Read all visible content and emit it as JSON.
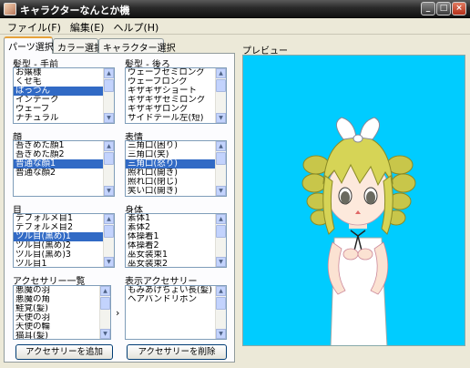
{
  "window": {
    "title": "キャラクターなんとか機",
    "buttons": {
      "minimize": "_",
      "maximize": "□",
      "close": "×"
    }
  },
  "menu": [
    "ファイル(F)",
    "編集(E)",
    "ヘルプ(H)"
  ],
  "tabs": [
    "パーツ選択",
    "カラー選択",
    "キャラクター選択"
  ],
  "parts": {
    "hair_front": {
      "label": "髪型 - 手前",
      "items": [
        "お嬢様",
        "くせ毛",
        "ぱっつん",
        "インテーク",
        "ウェーブ",
        "ナチュラル"
      ],
      "selected_index": 2
    },
    "hair_back": {
      "label": "髪型 - 後ろ",
      "items": [
        "ウェーブセミロング",
        "ウェーブロング",
        "ギザギザショート",
        "ギザギザセミロング",
        "ギザギザロング",
        "サイドテール左(短)"
      ],
      "selected_index": -1
    },
    "face": {
      "label": "顔",
      "items": [
        "吾ぎめた顔1",
        "吾ぎめた顔2",
        "普通な顔1",
        "普通な顔2"
      ],
      "selected_index": 2
    },
    "expression": {
      "label": "表情",
      "items": [
        "三角口(困り)",
        "三角口(笑)",
        "三角口(怒り)",
        "照れ口(開き)",
        "照れ口(閉じ)",
        "笑い口(開き)"
      ],
      "selected_index": 2
    },
    "eyes": {
      "label": "目",
      "items": [
        "デフォルメ目1",
        "デフォルメ目2",
        "ツル目(黒め)1",
        "ツル目(黒め)2",
        "ツル目(黒め)3",
        "ツル目1"
      ],
      "selected_index": 2
    },
    "body": {
      "label": "身体",
      "items": [
        "素体1",
        "素体2",
        "体操着1",
        "体操着2",
        "巫女装束1",
        "巫女装束2"
      ],
      "selected_index": -1
    },
    "accessory_list": {
      "label": "アクセサリー一覧",
      "items": [
        "悪魔の羽",
        "悪魔の角",
        "鮭覚(髪)",
        "天使の羽",
        "天使の輪",
        "猫耳(髪)"
      ],
      "selected_index": -1
    },
    "accessory_shown": {
      "label": "表示アクセサリー",
      "items": [
        "もみあげちょい長(髪)",
        "ヘアバンドリボン"
      ],
      "selected_index": -1
    },
    "move_arrow": "›",
    "add_button": "アクセサリーを追加",
    "remove_button": "アクセサリーを削除"
  },
  "preview": {
    "label": "プレビュー",
    "background_color": "#00ccff"
  },
  "icons": [
    "app-icon",
    "minimize-icon",
    "maximize-icon",
    "close-icon",
    "scroll-up-icon",
    "scroll-down-icon"
  ]
}
